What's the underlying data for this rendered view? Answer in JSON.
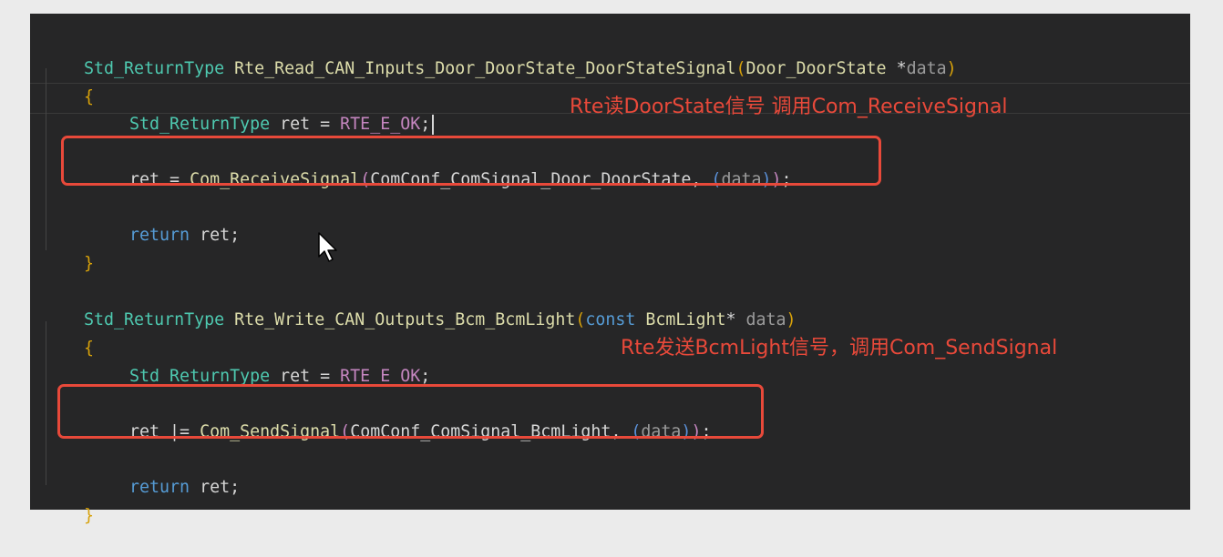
{
  "colors": {
    "page_bg": "#ebebeb",
    "editor_bg": "#262627",
    "annotation": "#e8493a",
    "type": "#4ec9b0",
    "function": "#dcdcaa",
    "keyword": "#569cd6",
    "macro": "#c586c0",
    "parameter": "#9b9b9b"
  },
  "code": {
    "fn1": {
      "sig_type": "Std_ReturnType",
      "sig_name": "Rte_Read_CAN_Inputs_Door_DoorState_DoorStateSignal",
      "sig_open": "(",
      "sig_argtype": "Door_DoorState",
      "sig_star": " *",
      "sig_param": "data",
      "sig_close": ")",
      "open_brace": "{",
      "decl_type": "Std_ReturnType",
      "decl_rest": " ret = ",
      "decl_macro": "RTE_E_OK",
      "decl_semi": ";",
      "call_lhs": "ret = ",
      "call_fn": "Com_ReceiveSignal",
      "call_open": "(",
      "call_arg": "ComConf_ComSignal_Door_DoorState, ",
      "call_inner_open": "(",
      "call_param": "data",
      "call_inner_close": ")",
      "call_close": ")",
      "call_semi": ";",
      "return_kw": "return",
      "return_rest": " ret;",
      "close_brace": "}"
    },
    "fn2": {
      "sig_type": "Std_ReturnType",
      "sig_name": "Rte_Write_CAN_Outputs_Bcm_BcmLight",
      "sig_open": "(",
      "sig_const": "const",
      "sig_argtype": " BcmLight",
      "sig_star": "* ",
      "sig_param": "data",
      "sig_close": ")",
      "open_brace": "{",
      "decl_type": "Std_ReturnType",
      "decl_rest": " ret = ",
      "decl_macro": "RTE_E_OK",
      "decl_semi": ";",
      "call_lhs": "ret |= ",
      "call_fn": "Com_SendSignal",
      "call_open": "(",
      "call_arg": "ComConf_ComSignal_BcmLight, ",
      "call_inner_open": "(",
      "call_param": "data",
      "call_inner_close": ")",
      "call_close": ")",
      "call_semi": ";",
      "return_kw": "return",
      "return_rest": " ret;",
      "close_brace": "}"
    }
  },
  "annotations": {
    "note1": "Rte读DoorState信号 调用Com_ReceiveSignal",
    "note2": "Rte发送BcmLight信号，调用Com_SendSignal"
  }
}
